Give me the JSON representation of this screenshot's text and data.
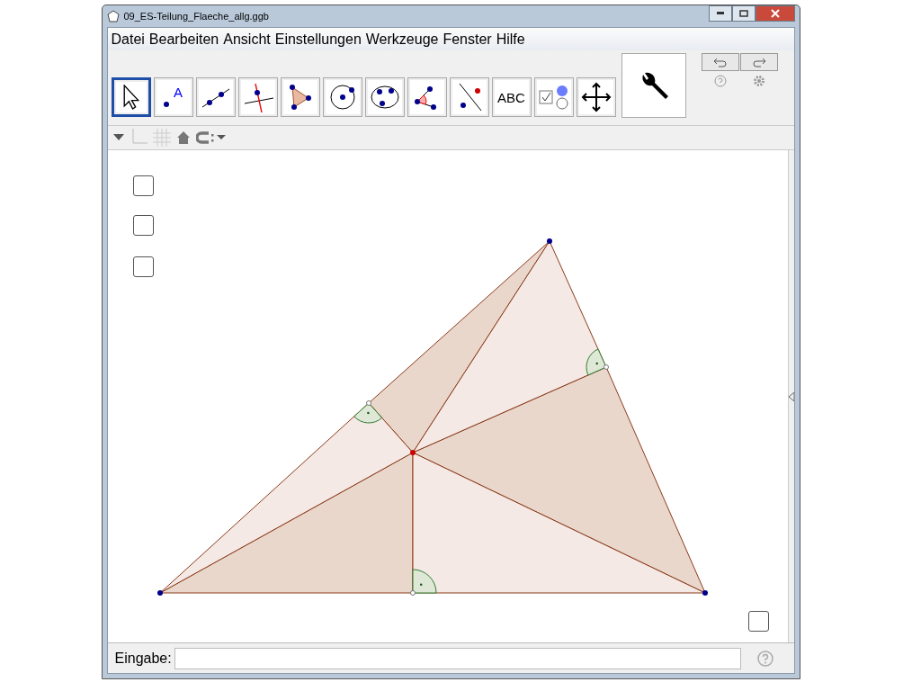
{
  "window": {
    "title": "09_ES-Teilung_Flaeche_allg.ggb"
  },
  "menu": [
    "Datei",
    "Bearbeiten",
    "Ansicht",
    "Einstellungen",
    "Werkzeuge",
    "Fenster",
    "Hilfe"
  ],
  "tools": [
    {
      "kind": "move",
      "selected": true
    },
    {
      "kind": "point",
      "label": "A",
      "selected": false
    },
    {
      "kind": "line",
      "selected": false
    },
    {
      "kind": "perpendicular",
      "selected": false
    },
    {
      "kind": "polygon",
      "selected": false
    },
    {
      "kind": "circle",
      "selected": false
    },
    {
      "kind": "conic",
      "selected": false
    },
    {
      "kind": "angle",
      "selected": false
    },
    {
      "kind": "reflect",
      "selected": false
    },
    {
      "kind": "text",
      "label": "ABC",
      "selected": false
    },
    {
      "kind": "checkbox",
      "selected": false
    },
    {
      "kind": "pan",
      "selected": false
    }
  ],
  "checkboxes": [
    {
      "checked": false
    },
    {
      "checked": false
    },
    {
      "checked": false
    },
    {
      "checked": false
    }
  ],
  "input": {
    "label": "Eingabe:"
  }
}
